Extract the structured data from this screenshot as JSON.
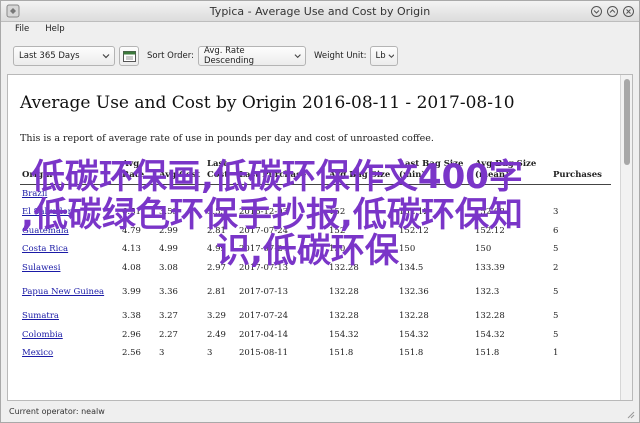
{
  "window": {
    "title": "Typica - Average Use and Cost by Origin"
  },
  "menu": {
    "items": [
      "File",
      "Help"
    ]
  },
  "toolbar": {
    "date_range": "Last 365 Days",
    "sort_label": "Sort Order:",
    "sort_value": "Avg. Rate Descending",
    "weight_label": "Weight Unit:",
    "weight_value": "Lb"
  },
  "report": {
    "title": "Average Use and Cost by Origin 2016-08-11 - 2017-08-10",
    "description": "This is a report of average rate of use in pounds per day and cost of unroasted coffee.",
    "header_top": "Unit Cost",
    "columns": [
      "Origin",
      "Avg Rate",
      "Avg Cost",
      "Last Cost",
      "Last Purchase",
      "Avg Bag Size",
      "Last Bag Size (min)",
      "Avg Bag Size (mean)",
      "Purchases"
    ],
    "rows": [
      {
        "origin": "Brazil",
        "avg_rate": "",
        "avg_cost": "",
        "last_cost": "",
        "date": "",
        "bag1": "",
        "bag2": "",
        "bag3": "",
        "purchases": ""
      },
      {
        "origin": "El Salvador",
        "avg_rate": "6.51",
        "avg_cost": "3.55",
        "last_cost": "3.55",
        "date": "2016-12-03",
        "bag1": "152",
        "bag2": "152.12",
        "bag3": "152.08",
        "purchases": "3"
      },
      {
        "origin": "Guatemala",
        "avg_rate": "4.79",
        "avg_cost": "2.99",
        "last_cost": "2.81",
        "date": "2017-07-24",
        "bag1": "152",
        "bag2": "152.12",
        "bag3": "152.12",
        "purchases": "6"
      },
      {
        "origin": "Costa Rica",
        "avg_rate": "4.13",
        "avg_cost": "4.99",
        "last_cost": "4.99",
        "date": "2017-07-24",
        "bag1": "150",
        "bag2": "150",
        "bag3": "150",
        "purchases": "5"
      },
      {
        "origin": "Sulawesi",
        "avg_rate": "4.08",
        "avg_cost": "3.08",
        "last_cost": "2.97",
        "date": "2017-07-13",
        "bag1": "132.28",
        "bag2": "134.5",
        "bag3": "133.39",
        "purchases": "2"
      },
      {
        "origin": "Papua New Guinea",
        "avg_rate": "3.99",
        "avg_cost": "3.36",
        "last_cost": "2.81",
        "date": "2017-07-13",
        "bag1": "132.28",
        "bag2": "132.36",
        "bag3": "132.3",
        "purchases": "5"
      },
      {
        "origin": "Sumatra",
        "avg_rate": "3.38",
        "avg_cost": "3.27",
        "last_cost": "3.29",
        "date": "2017-07-24",
        "bag1": "132.28",
        "bag2": "132.28",
        "bag3": "132.28",
        "purchases": "5"
      },
      {
        "origin": "Colombia",
        "avg_rate": "2.96",
        "avg_cost": "2.27",
        "last_cost": "2.49",
        "date": "2017-04-14",
        "bag1": "154.32",
        "bag2": "154.32",
        "bag3": "154.32",
        "purchases": "5"
      },
      {
        "origin": "Mexico",
        "avg_rate": "2.56",
        "avg_cost": "3",
        "last_cost": "3",
        "date": "2015-08-11",
        "bag1": "151.8",
        "bag2": "151.8",
        "bag3": "151.8",
        "purchases": "1"
      }
    ]
  },
  "overlay": {
    "line1": "低碳环保画,低碳环保作文400字",
    "line2": ",低碳绿色环保手抄报,低碳环保知",
    "line3": "识,低碳环保"
  },
  "status": {
    "text": "Current operator: nealw"
  },
  "icons": [
    "app-icon",
    "minimize-icon",
    "maximize-icon",
    "close-icon",
    "calendar-icon",
    "chevron-down-icon",
    "resize-grip-icon"
  ],
  "colors": {
    "link": "#1a1aa6",
    "overlay": "#7a35c8"
  }
}
